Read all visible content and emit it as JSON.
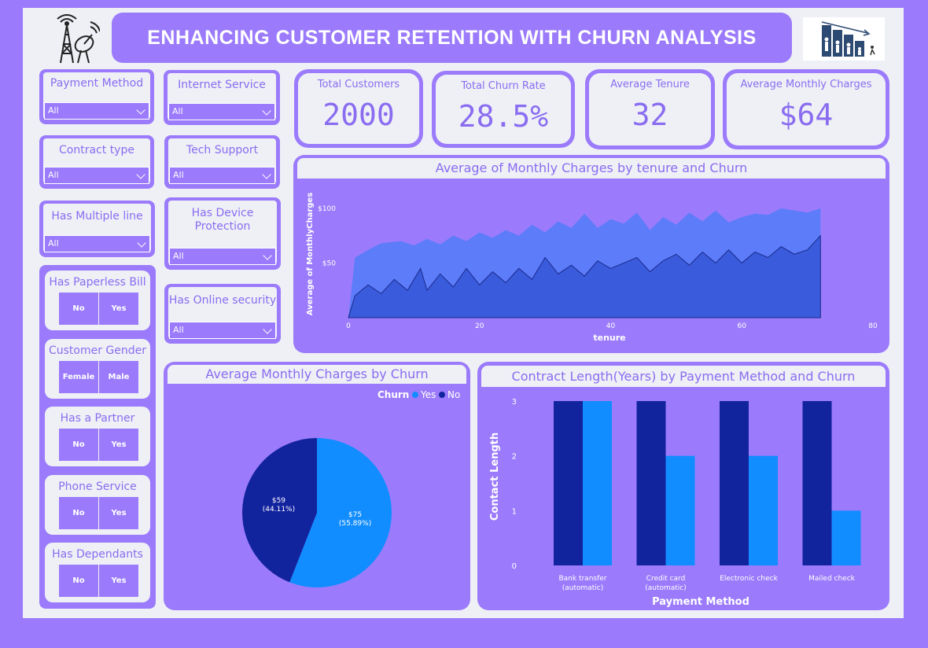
{
  "header": {
    "title": "ENHANCING CUSTOMER RETENTION WITH CHURN ANALYSIS",
    "left_logo": "telecom-tower-icon",
    "right_logo": "declining-customers-icon"
  },
  "slicers": {
    "payment_method": {
      "label": "Payment Method",
      "value": "All"
    },
    "internet_service": {
      "label": "Internet Service",
      "value": "All"
    },
    "contract_type": {
      "label": "Contract type",
      "value": "All"
    },
    "tech_support": {
      "label": "Tech Support",
      "value": "All"
    },
    "multiple_line": {
      "label": "Has Multiple line",
      "value": "All"
    },
    "device_protection": {
      "label": "Has Device Protection",
      "value": "All"
    },
    "online_security": {
      "label": "Has Online security",
      "value": "All"
    }
  },
  "button_slicers": {
    "paperless": {
      "label": "Has Paperless Bill",
      "a": "No",
      "b": "Yes"
    },
    "gender": {
      "label": "Customer Gender",
      "a": "Female",
      "b": "Male"
    },
    "partner": {
      "label": "Has a Partner",
      "a": "No",
      "b": "Yes"
    },
    "phone": {
      "label": "Phone Service",
      "a": "No",
      "b": "Yes"
    },
    "dependants": {
      "label": "Has Dependants",
      "a": "No",
      "b": "Yes"
    }
  },
  "kpis": {
    "customers": {
      "label": "Total Customers",
      "value": "2000"
    },
    "churn_rate": {
      "label": "Total Churn Rate",
      "value": "28.5%"
    },
    "tenure": {
      "label": "Average Tenure",
      "value": "32"
    },
    "charges": {
      "label": "Average Monthly Charges",
      "value": "$64"
    }
  },
  "colors": {
    "accent": "#9b7bfb",
    "panel_bg": "#eef0f6",
    "yes": "#118dff",
    "no": "#12239e",
    "area_no": "#5c7cfa",
    "area_yes": "#3a5bdc"
  },
  "chart_data": [
    {
      "type": "area",
      "title": "Average of Monthly Charges by tenure and Churn",
      "xlabel": "tenure",
      "ylabel": "Average of MonthlyCharges",
      "xlim": [
        0,
        80
      ],
      "ylim": [
        0,
        120
      ],
      "xticks": [
        "0",
        "20",
        "40",
        "60",
        "80"
      ],
      "yticks": [
        "$50",
        "$100"
      ],
      "series": [
        {
          "values": [
            [
              0,
              0
            ],
            [
              1,
              55
            ],
            [
              3,
              62
            ],
            [
              5,
              68
            ],
            [
              8,
              70
            ],
            [
              10,
              66
            ],
            [
              12,
              72
            ],
            [
              14,
              67
            ],
            [
              16,
              75
            ],
            [
              18,
              70
            ],
            [
              20,
              78
            ],
            [
              22,
              73
            ],
            [
              24,
              80
            ],
            [
              26,
              75
            ],
            [
              28,
              85
            ],
            [
              30,
              78
            ],
            [
              32,
              88
            ],
            [
              34,
              82
            ],
            [
              36,
              95
            ],
            [
              38,
              82
            ],
            [
              40,
              90
            ],
            [
              42,
              86
            ],
            [
              44,
              96
            ],
            [
              46,
              80
            ],
            [
              48,
              92
            ],
            [
              50,
              85
            ],
            [
              52,
              96
            ],
            [
              54,
              88
            ],
            [
              56,
              98
            ],
            [
              58,
              87
            ],
            [
              60,
              92
            ],
            [
              62,
              95
            ],
            [
              64,
              94
            ],
            [
              66,
              100
            ],
            [
              68,
              98
            ],
            [
              70,
              96
            ],
            [
              72,
              100
            ],
            [
              72,
              0
            ]
          ]
        },
        {
          "values": [
            [
              0,
              0
            ],
            [
              1,
              20
            ],
            [
              3,
              30
            ],
            [
              5,
              22
            ],
            [
              7,
              35
            ],
            [
              9,
              25
            ],
            [
              11,
              45
            ],
            [
              12,
              25
            ],
            [
              14,
              40
            ],
            [
              16,
              28
            ],
            [
              18,
              45
            ],
            [
              20,
              30
            ],
            [
              22,
              42
            ],
            [
              24,
              32
            ],
            [
              26,
              45
            ],
            [
              28,
              35
            ],
            [
              30,
              55
            ],
            [
              32,
              40
            ],
            [
              34,
              48
            ],
            [
              36,
              38
            ],
            [
              38,
              52
            ],
            [
              40,
              45
            ],
            [
              42,
              50
            ],
            [
              44,
              55
            ],
            [
              46,
              42
            ],
            [
              48,
              52
            ],
            [
              50,
              58
            ],
            [
              52,
              48
            ],
            [
              54,
              60
            ],
            [
              56,
              50
            ],
            [
              58,
              62
            ],
            [
              60,
              50
            ],
            [
              62,
              60
            ],
            [
              64,
              55
            ],
            [
              66,
              65
            ],
            [
              68,
              58
            ],
            [
              70,
              62
            ],
            [
              72,
              75
            ],
            [
              72,
              0
            ]
          ]
        }
      ]
    },
    {
      "type": "pie",
      "title": "Average Monthly Charges by Churn",
      "legend_title": "Churn",
      "categories": [
        "Yes",
        "No"
      ],
      "values": [
        75,
        59
      ],
      "labels": [
        "$75\n(55.89%)",
        "$59\n(44.11%)"
      ]
    },
    {
      "type": "bar",
      "title": "Contract Length(Years) by Payment Method and Churn",
      "xlabel": "Payment Method",
      "ylabel": "Contact Length",
      "categories": [
        "Bank transfer (automatic)",
        "Credit card (automatic)",
        "Electronic check",
        "Mailed check"
      ],
      "ylim": [
        0,
        3
      ],
      "series": [
        {
          "values": [
            3,
            3,
            3,
            3
          ]
        },
        {
          "values": [
            3,
            2,
            2,
            1
          ]
        }
      ]
    }
  ]
}
